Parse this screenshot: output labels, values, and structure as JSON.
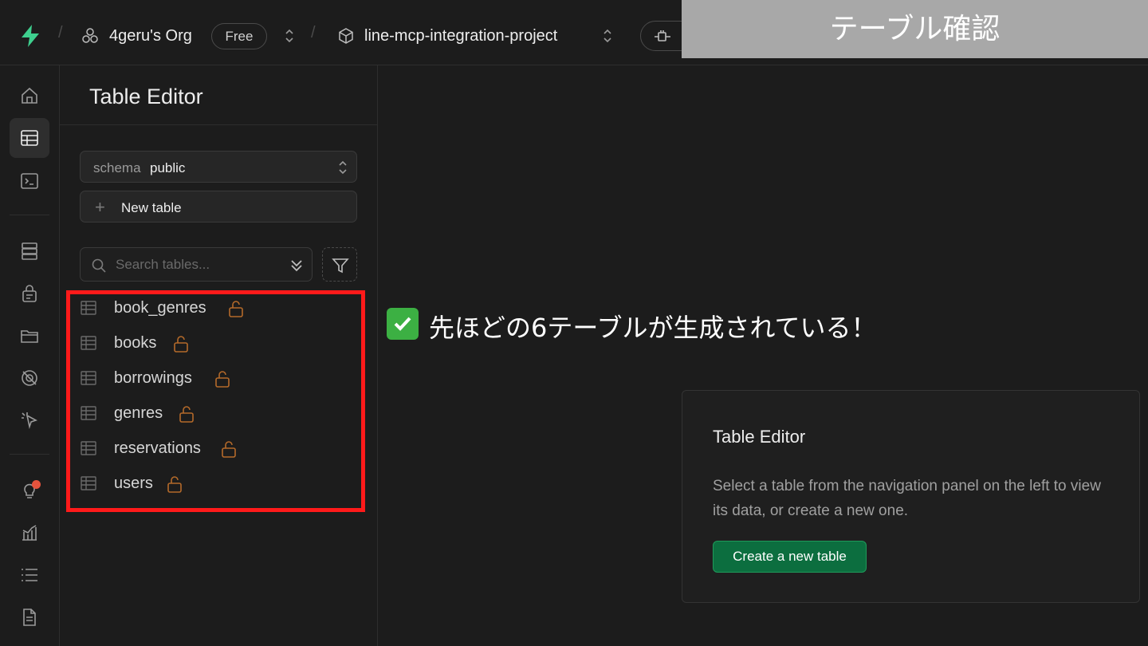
{
  "topbar": {
    "org_name": "4geru's Org",
    "plan_badge": "Free",
    "project_name": "line-mcp-integration-project",
    "overlay_title": "テーブル確認"
  },
  "sidebar": {
    "title": "Table Editor",
    "schema": {
      "label": "schema",
      "value": "public"
    },
    "new_table_label": "New table",
    "search": {
      "placeholder": "Search tables..."
    },
    "tables": [
      {
        "name": "book_genres"
      },
      {
        "name": "books"
      },
      {
        "name": "borrowings"
      },
      {
        "name": "genres"
      },
      {
        "name": "reservations"
      },
      {
        "name": "users"
      }
    ]
  },
  "annotation": {
    "text": "先ほどの6テーブルが生成されている！"
  },
  "empty_state": {
    "title": "Table Editor",
    "description": "Select a table from the navigation panel on the left to view its data, or create a new one.",
    "button_label": "Create a new table"
  },
  "colors": {
    "brand_green": "#3ecf8e",
    "button_green": "#0c6e3f",
    "lock_orange": "#b46a2a",
    "highlight_red": "#ff1a1a"
  },
  "icons": {
    "rail": [
      "home-icon",
      "table-editor-icon",
      "sql-editor-icon",
      "database-icon",
      "auth-icon",
      "storage-icon",
      "realtime-icon",
      "edge-functions-icon",
      "advisors-icon",
      "reports-icon",
      "logs-icon",
      "docs-icon"
    ]
  }
}
